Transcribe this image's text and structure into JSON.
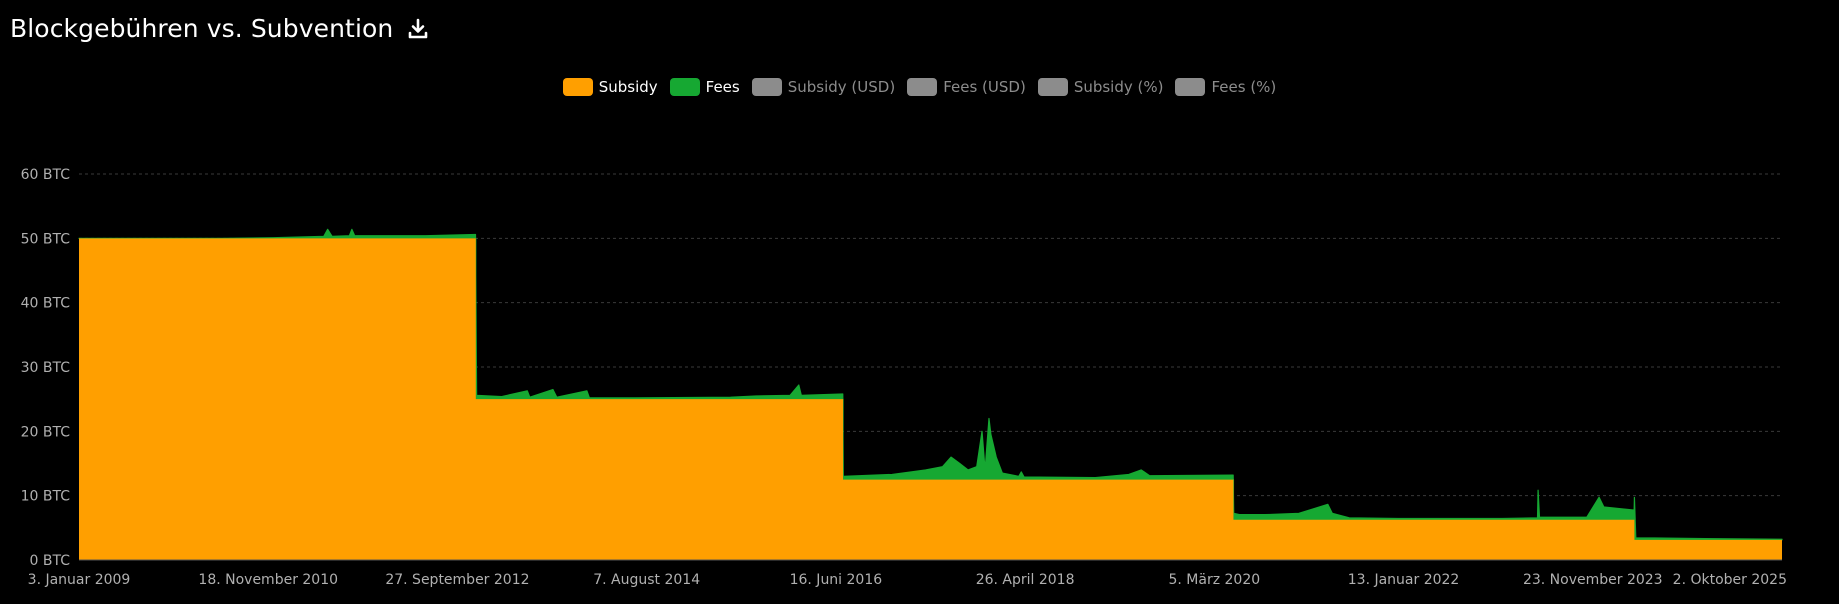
{
  "title": "Blockgebühren vs. Subvention",
  "download_icon": "download-icon",
  "legend": [
    {
      "label": "Subsidy",
      "color": "#ff9f00",
      "active": true
    },
    {
      "label": "Fees",
      "color": "#16a832",
      "active": true
    },
    {
      "label": "Subsidy (USD)",
      "color": "#8c8c8c",
      "active": false
    },
    {
      "label": "Fees (USD)",
      "color": "#8c8c8c",
      "active": false
    },
    {
      "label": "Subsidy (%)",
      "color": "#8c8c8c",
      "active": false
    },
    {
      "label": "Fees (%)",
      "color": "#8c8c8c",
      "active": false
    }
  ],
  "chart_data": {
    "type": "area",
    "stacked": true,
    "title": "Blockgebühren vs. Subvention",
    "xlabel": "",
    "ylabel": "",
    "ylim": [
      0,
      60
    ],
    "y_ticks": [
      0,
      10,
      20,
      30,
      40,
      50,
      60
    ],
    "y_unit": "BTC",
    "grid": true,
    "legend_position": "top-center",
    "x_tick_labels": [
      "3. Januar 2009",
      "18. November 2010",
      "27. September 2012",
      "7. August 2014",
      "16. Juni 2016",
      "26. April 2018",
      "5. März 2020",
      "13. Januar 2022",
      "23. November 2023",
      "2. Oktober 2025"
    ],
    "x_range": [
      "2009-01-03",
      "2025-10-02"
    ],
    "series": [
      {
        "name": "Subsidy",
        "color": "#ff9f00",
        "points": [
          [
            "2009-01-03",
            50
          ],
          [
            "2012-11-28",
            50
          ],
          [
            "2012-11-28",
            25
          ],
          [
            "2016-07-09",
            25
          ],
          [
            "2016-07-09",
            12.5
          ],
          [
            "2020-05-11",
            12.5
          ],
          [
            "2020-05-11",
            6.25
          ],
          [
            "2024-04-20",
            6.25
          ],
          [
            "2024-04-20",
            3.125
          ],
          [
            "2025-10-02",
            3.125
          ]
        ]
      },
      {
        "name": "Fees",
        "color": "#16a832",
        "points": [
          [
            "2009-01-03",
            0
          ],
          [
            "2010-06-01",
            0
          ],
          [
            "2010-12-01",
            0.1
          ],
          [
            "2011-06-01",
            0.3
          ],
          [
            "2011-06-15",
            1.4
          ],
          [
            "2011-07-01",
            0.3
          ],
          [
            "2011-09-01",
            0.4
          ],
          [
            "2011-09-10",
            1.4
          ],
          [
            "2011-09-20",
            0.4
          ],
          [
            "2012-06-01",
            0.4
          ],
          [
            "2012-11-27",
            0.6
          ],
          [
            "2012-12-01",
            0.6
          ],
          [
            "2013-03-01",
            0.4
          ],
          [
            "2013-06-01",
            1.3
          ],
          [
            "2013-06-10",
            0.3
          ],
          [
            "2013-09-01",
            1.5
          ],
          [
            "2013-09-15",
            0.3
          ],
          [
            "2014-01-01",
            1.3
          ],
          [
            "2014-01-10",
            0.2
          ],
          [
            "2014-06-01",
            0.2
          ],
          [
            "2015-06-01",
            0.3
          ],
          [
            "2015-09-01",
            0.5
          ],
          [
            "2016-01-01",
            0.6
          ],
          [
            "2016-02-01",
            2.2
          ],
          [
            "2016-02-10",
            0.6
          ],
          [
            "2016-07-08",
            0.8
          ],
          [
            "2016-07-10",
            0.5
          ],
          [
            "2017-01-01",
            0.8
          ],
          [
            "2017-05-01",
            1.5
          ],
          [
            "2017-07-01",
            2.0
          ],
          [
            "2017-08-01",
            3.5
          ],
          [
            "2017-09-01",
            2.5
          ],
          [
            "2017-10-01",
            1.5
          ],
          [
            "2017-11-01",
            2.0
          ],
          [
            "2017-11-20",
            7.5
          ],
          [
            "2017-12-01",
            1.5
          ],
          [
            "2017-12-15",
            9.5
          ],
          [
            "2017-12-22",
            7.0
          ],
          [
            "2018-01-10",
            3.5
          ],
          [
            "2018-02-01",
            1.0
          ],
          [
            "2018-04-01",
            0.5
          ],
          [
            "2018-04-10",
            1.2
          ],
          [
            "2018-04-20",
            0.4
          ],
          [
            "2019-01-01",
            0.3
          ],
          [
            "2019-05-01",
            0.8
          ],
          [
            "2019-06-15",
            1.5
          ],
          [
            "2019-07-15",
            0.6
          ],
          [
            "2020-05-10",
            0.7
          ],
          [
            "2020-05-12",
            1.0
          ],
          [
            "2020-06-01",
            0.8
          ],
          [
            "2020-09-01",
            0.8
          ],
          [
            "2021-01-01",
            1.0
          ],
          [
            "2021-04-15",
            2.4
          ],
          [
            "2021-05-01",
            1.0
          ],
          [
            "2021-07-01",
            0.3
          ],
          [
            "2022-01-01",
            0.2
          ],
          [
            "2023-01-01",
            0.2
          ],
          [
            "2023-05-08",
            0.3
          ],
          [
            "2023-05-10",
            4.6
          ],
          [
            "2023-05-15",
            0.4
          ],
          [
            "2023-11-01",
            0.4
          ],
          [
            "2023-12-15",
            3.5
          ],
          [
            "2024-01-01",
            2.0
          ],
          [
            "2024-04-19",
            1.5
          ],
          [
            "2024-04-20",
            6.6
          ],
          [
            "2024-04-25",
            0.3
          ],
          [
            "2024-07-01",
            0.3
          ],
          [
            "2025-01-01",
            0.2
          ],
          [
            "2025-10-02",
            0.1
          ]
        ]
      }
    ]
  }
}
